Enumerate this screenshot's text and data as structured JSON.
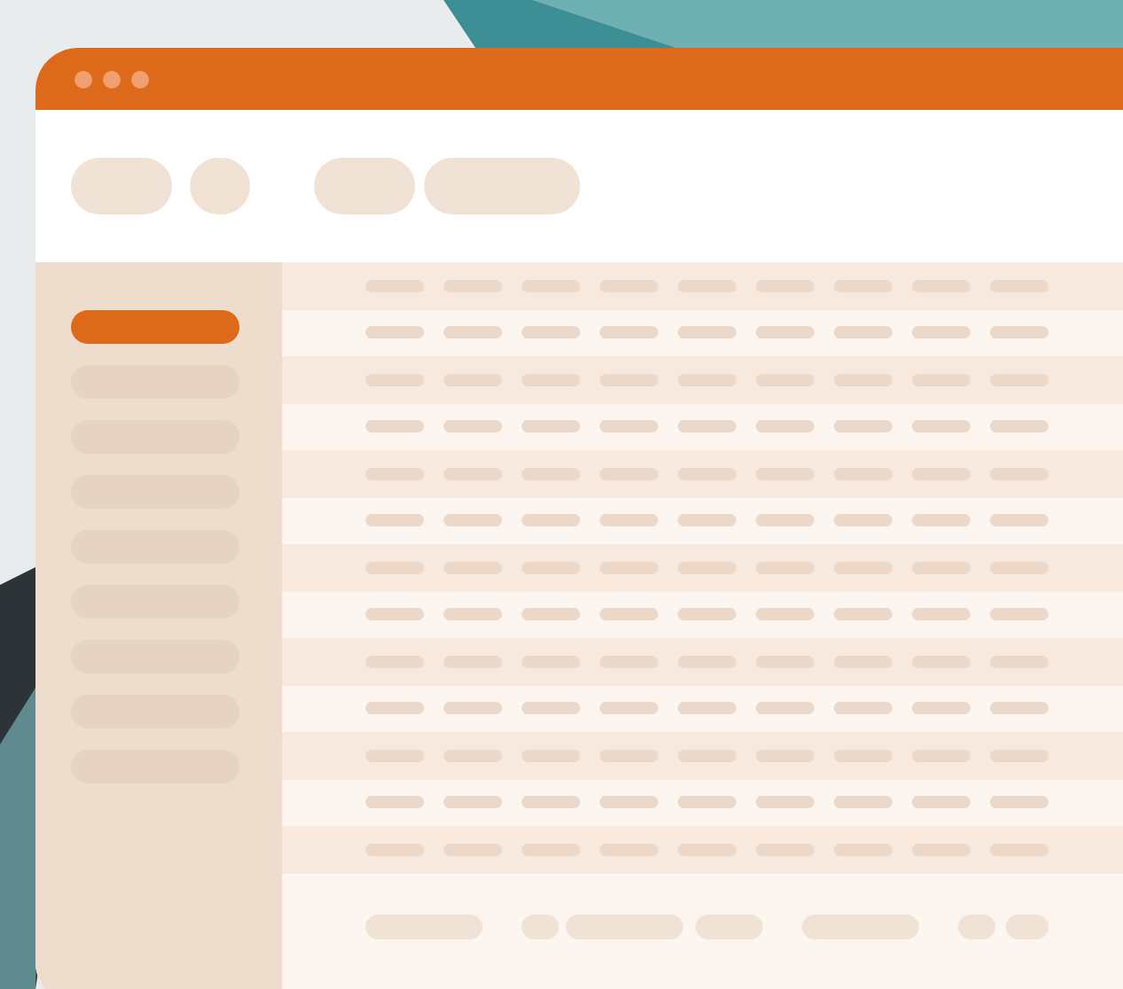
{
  "sidebar": {
    "items": [
      {
        "selected": true
      },
      {
        "selected": false
      },
      {
        "selected": false
      },
      {
        "selected": false
      },
      {
        "selected": false
      },
      {
        "selected": false
      },
      {
        "selected": false
      },
      {
        "selected": false
      },
      {
        "selected": false
      }
    ]
  }
}
